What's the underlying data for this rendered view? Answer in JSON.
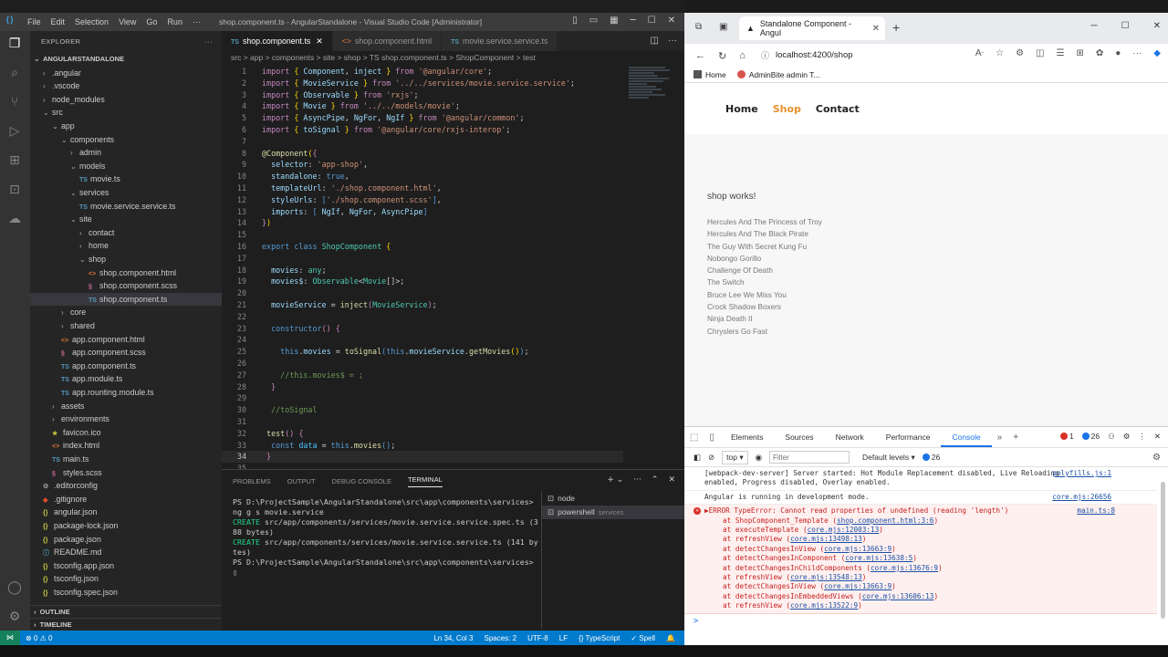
{
  "vscode": {
    "menu": [
      "File",
      "Edit",
      "Selection",
      "View",
      "Go",
      "Run",
      "···"
    ],
    "window_title": "shop.component.ts - AngularStandalone - Visual Studio Code [Administrator]",
    "explorer_title": "EXPLORER",
    "project_name": "ANGULARSTANDALONE",
    "tree": [
      {
        "label": ".angular",
        "depth": 1,
        "type": "folder-closed"
      },
      {
        "label": ".vscode",
        "depth": 1,
        "type": "folder-closed"
      },
      {
        "label": "node_modules",
        "depth": 1,
        "type": "folder-closed"
      },
      {
        "label": "src",
        "depth": 1,
        "type": "folder-open"
      },
      {
        "label": "app",
        "depth": 2,
        "type": "folder-open"
      },
      {
        "label": "components",
        "depth": 3,
        "type": "folder-open"
      },
      {
        "label": "admin",
        "depth": 4,
        "type": "folder-closed"
      },
      {
        "label": "models",
        "depth": 4,
        "type": "folder-open"
      },
      {
        "label": "movie.ts",
        "depth": 5,
        "type": "ts"
      },
      {
        "label": "services",
        "depth": 4,
        "type": "folder-open"
      },
      {
        "label": "movie.service.service.ts",
        "depth": 5,
        "type": "ts"
      },
      {
        "label": "site",
        "depth": 4,
        "type": "folder-open"
      },
      {
        "label": "contact",
        "depth": 5,
        "type": "folder-closed"
      },
      {
        "label": "home",
        "depth": 5,
        "type": "folder-closed"
      },
      {
        "label": "shop",
        "depth": 5,
        "type": "folder-open"
      },
      {
        "label": "shop.component.html",
        "depth": 6,
        "type": "html"
      },
      {
        "label": "shop.component.scss",
        "depth": 6,
        "type": "scss"
      },
      {
        "label": "shop.component.ts",
        "depth": 6,
        "type": "ts",
        "selected": true
      },
      {
        "label": "core",
        "depth": 3,
        "type": "folder-closed"
      },
      {
        "label": "shared",
        "depth": 3,
        "type": "folder-closed"
      },
      {
        "label": "app.component.html",
        "depth": 3,
        "type": "html"
      },
      {
        "label": "app.component.scss",
        "depth": 3,
        "type": "scss"
      },
      {
        "label": "app.component.ts",
        "depth": 3,
        "type": "ts"
      },
      {
        "label": "app.module.ts",
        "depth": 3,
        "type": "ts"
      },
      {
        "label": "app.rounting.module.ts",
        "depth": 3,
        "type": "ts"
      },
      {
        "label": "assets",
        "depth": 2,
        "type": "folder-closed"
      },
      {
        "label": "environments",
        "depth": 2,
        "type": "folder-closed"
      },
      {
        "label": "favicon.ico",
        "depth": 2,
        "type": "ico"
      },
      {
        "label": "index.html",
        "depth": 2,
        "type": "html"
      },
      {
        "label": "main.ts",
        "depth": 2,
        "type": "ts"
      },
      {
        "label": "styles.scss",
        "depth": 2,
        "type": "scss"
      },
      {
        "label": ".editorconfig",
        "depth": 1,
        "type": "config"
      },
      {
        "label": ".gitignore",
        "depth": 1,
        "type": "git"
      },
      {
        "label": "angular.json",
        "depth": 1,
        "type": "json"
      },
      {
        "label": "package-lock.json",
        "depth": 1,
        "type": "json"
      },
      {
        "label": "package.json",
        "depth": 1,
        "type": "json"
      },
      {
        "label": "README.md",
        "depth": 1,
        "type": "md"
      },
      {
        "label": "tsconfig.app.json",
        "depth": 1,
        "type": "json"
      },
      {
        "label": "tsconfig.json",
        "depth": 1,
        "type": "json"
      },
      {
        "label": "tsconfig.spec.json",
        "depth": 1,
        "type": "json"
      }
    ],
    "outline_label": "OUTLINE",
    "timeline_label": "TIMELINE",
    "tabs": [
      {
        "prefix": "TS",
        "label": "shop.component.ts",
        "active": true
      },
      {
        "prefix": "<>",
        "label": "shop.component.html",
        "active": false
      },
      {
        "prefix": "TS",
        "label": "movie.service.service.ts",
        "active": false
      }
    ],
    "breadcrumb": "src > app > components > site > shop > TS shop.component.ts > ShopComponent > test",
    "code_lines": [
      {
        "n": "1",
        "html": "<span class='k'>import</span> <span class='y'>{</span> <span class='v'>Component</span>, <span class='v'>inject</span> <span class='y'>}</span> <span class='k'>from</span> <span class='s'>'@angular/core'</span>;"
      },
      {
        "n": "2",
        "html": "<span class='k'>import</span> <span class='y'>{</span> <span class='v'>MovieService</span> <span class='y'>}</span> <span class='k'>from</span> <span class='s'>'../../services/movie.service.service'</span>;"
      },
      {
        "n": "3",
        "html": "<span class='k'>import</span> <span class='y'>{</span> <span class='v'>Observable</span> <span class='y'>}</span> <span class='k'>from</span> <span class='s'>'rxjs'</span>;"
      },
      {
        "n": "4",
        "html": "<span class='k'>import</span> <span class='y'>{</span> <span class='v'>Movie</span> <span class='y'>}</span> <span class='k'>from</span> <span class='s'>'../../models/movie'</span>;"
      },
      {
        "n": "5",
        "html": "<span class='k'>import</span> <span class='y'>{</span> <span class='v'>AsyncPipe</span>, <span class='v'>NgFor</span>, <span class='v'>NgIf</span> <span class='y'>}</span> <span class='k'>from</span> <span class='s'>'@angular/common'</span>;"
      },
      {
        "n": "6",
        "html": "<span class='k'>import</span> <span class='y'>{</span> <span class='v'>toSignal</span> <span class='y'>}</span> <span class='k'>from</span> <span class='s'>'@angular/core/rxjs-interop'</span>;"
      },
      {
        "n": "7",
        "html": ""
      },
      {
        "n": "8",
        "html": "<span class='f'>@Component</span><span class='y'>(</span><span class='k'>{</span>"
      },
      {
        "n": "9",
        "html": "  <span class='v'>selector</span>: <span class='s'>'app-shop'</span>,"
      },
      {
        "n": "10",
        "html": "  <span class='v'>standalone</span>: <span class='kw'>true</span>,"
      },
      {
        "n": "11",
        "html": "  <span class='v'>templateUrl</span>: <span class='s'>'./shop.component.html'</span>,"
      },
      {
        "n": "12",
        "html": "  <span class='v'>styleUrls</span>: <span class='kw'>[</span><span class='s'>'./shop.component.scss'</span><span class='kw'>]</span>,"
      },
      {
        "n": "13",
        "html": "  <span class='v'>imports</span>: <span class='kw'>[</span> <span class='v'>NgIf</span>, <span class='v'>NgFor</span>, <span class='v'>AsyncPipe</span><span class='kw'>]</span>"
      },
      {
        "n": "14",
        "html": "<span class='k'>}</span><span class='y'>)</span>"
      },
      {
        "n": "15",
        "html": ""
      },
      {
        "n": "16",
        "html": "<span class='kw'>export</span> <span class='kw'>class</span> <span class='t'>ShopComponent</span> <span class='y'>{</span>"
      },
      {
        "n": "17",
        "html": ""
      },
      {
        "n": "18",
        "html": "  <span class='v'>movies</span>: <span class='t'>any</span>;"
      },
      {
        "n": "19",
        "html": "  <span class='v'>movies$</span>: <span class='t'>Observable</span>&lt;<span class='t'>Movie</span>[]&gt;;"
      },
      {
        "n": "20",
        "html": ""
      },
      {
        "n": "21",
        "html": "  <span class='v'>movieService</span> = <span class='f'>inject</span><span class='k'>(</span><span class='t'>MovieService</span><span class='k'>)</span>;"
      },
      {
        "n": "22",
        "html": ""
      },
      {
        "n": "23",
        "html": "  <span class='kw'>constructor</span><span class='k'>()</span> <span class='k'>{</span>"
      },
      {
        "n": "24",
        "html": ""
      },
      {
        "n": "25",
        "html": "    <span class='kw'>this</span>.<span class='v'>movies</span> = <span class='f'>toSignal</span><span class='kw'>(</span><span class='kw'>this</span>.<span class='v'>movieService</span>.<span class='f'>getMovies</span><span class='y'>()</span><span class='kw'>)</span>;"
      },
      {
        "n": "26",
        "html": ""
      },
      {
        "n": "27",
        "html": "    <span class='c'>//this.movies$ = ;</span>"
      },
      {
        "n": "28",
        "html": "  <span class='k'>}</span>"
      },
      {
        "n": "29",
        "html": ""
      },
      {
        "n": "30",
        "html": "  <span class='c'>//toSignal</span>"
      },
      {
        "n": "31",
        "html": ""
      },
      {
        "n": "32",
        "html": " <span class='f'>test</span><span class='k'>()</span> <span class='k'>{</span>"
      },
      {
        "n": "33",
        "html": "  <span class='kw'>const</span> <span class='ok'>data</span> = <span class='kw'>this</span>.<span class='f'>movies</span><span class='kw'>()</span>;"
      },
      {
        "n": "34",
        "html": " <span class='k'>}</span>",
        "current": true
      },
      {
        "n": "35",
        "html": ""
      }
    ],
    "panel_tabs": [
      "PROBLEMS",
      "OUTPUT",
      "DEBUG CONSOLE",
      "TERMINAL"
    ],
    "terminal_lines": [
      {
        "text": "PS D:\\ProjectSample\\AngularStandalone\\src\\app\\components\\services> ng g s movie.service",
        "cls": ""
      },
      {
        "text": "CREATE src/app/components/services/movie.service.service.spec.ts (388 bytes)",
        "cls": "create"
      },
      {
        "text": "CREATE src/app/components/services/movie.service.service.ts (141 bytes)",
        "cls": "create"
      },
      {
        "text": "PS D:\\ProjectSample\\AngularStandalone\\src\\app\\components\\services> ▯",
        "cls": ""
      }
    ],
    "terminal_sessions": [
      {
        "label": "node",
        "sub": "",
        "active": false
      },
      {
        "label": "powershell",
        "sub": "services",
        "active": true
      }
    ],
    "status": {
      "problems": "⊗ 0 ⚠ 0",
      "position": "Ln 34, Col 3",
      "spaces": "Spaces: 2",
      "encoding": "UTF-8",
      "eol": "LF",
      "language": "{} TypeScript",
      "spell": "✓ Spell"
    }
  },
  "browser": {
    "tab_title": "Standalone Component - Angul",
    "url": "localhost:4200/shop",
    "bookmarks": [
      "Home",
      "AdminBite admin T..."
    ],
    "site_nav": [
      {
        "label": "Home",
        "active": false
      },
      {
        "label": "Shop",
        "active": true
      },
      {
        "label": "Contact",
        "active": false
      }
    ],
    "page_heading": "shop works!",
    "movies": [
      "Hercules And The Princess of Troy",
      "Hercules And The Black Pirate",
      "The Guy With Secret Kung Fu",
      "Nobongo Gorillo",
      "Challenge Of Death",
      "The Switch",
      "Bruce Lee We Miss You",
      "Crock Shadow Boxers",
      "Ninja Death II",
      "Chryslers Go Fast"
    ],
    "devtools": {
      "tabs": [
        "Elements",
        "Sources",
        "Network",
        "Performance",
        "Console"
      ],
      "active_tab": "Console",
      "error_count": "1",
      "info_count": "26",
      "context": "top",
      "filter_placeholder": "Filter",
      "levels": "Default levels",
      "levels_count": "26",
      "messages": [
        {
          "type": "log",
          "text": "[webpack-dev-server] Server started: Hot Module Replacement disabled, Live Reloading enabled, Progress disabled, Overlay enabled.",
          "src": "polyfills.js:1"
        },
        {
          "type": "log",
          "text": "Angular is running in development mode.",
          "src": "core.mjs:26656"
        }
      ],
      "error": {
        "text": "▶ERROR TypeError: Cannot read properties of undefined (reading 'length')",
        "src": "main.ts:8",
        "stack": [
          {
            "fn": "at ShopComponent_Template",
            "loc": "shop.component.html:3:6"
          },
          {
            "fn": "at executeTemplate",
            "loc": "core.mjs:12003:13"
          },
          {
            "fn": "at refreshView",
            "loc": "core.mjs:13498:13"
          },
          {
            "fn": "at detectChangesInView",
            "loc": "core.mjs:13663:9"
          },
          {
            "fn": "at detectChangesInComponent",
            "loc": "core.mjs:13638:5"
          },
          {
            "fn": "at detectChangesInChildComponents",
            "loc": "core.mjs:13676:9"
          },
          {
            "fn": "at refreshView",
            "loc": "core.mjs:13548:13"
          },
          {
            "fn": "at detectChangesInView",
            "loc": "core.mjs:13663:9"
          },
          {
            "fn": "at detectChangesInEmbeddedViews",
            "loc": "core.mjs:13606:13"
          },
          {
            "fn": "at refreshView",
            "loc": "core.mjs:13522:9"
          }
        ]
      },
      "prompt": ">"
    }
  }
}
